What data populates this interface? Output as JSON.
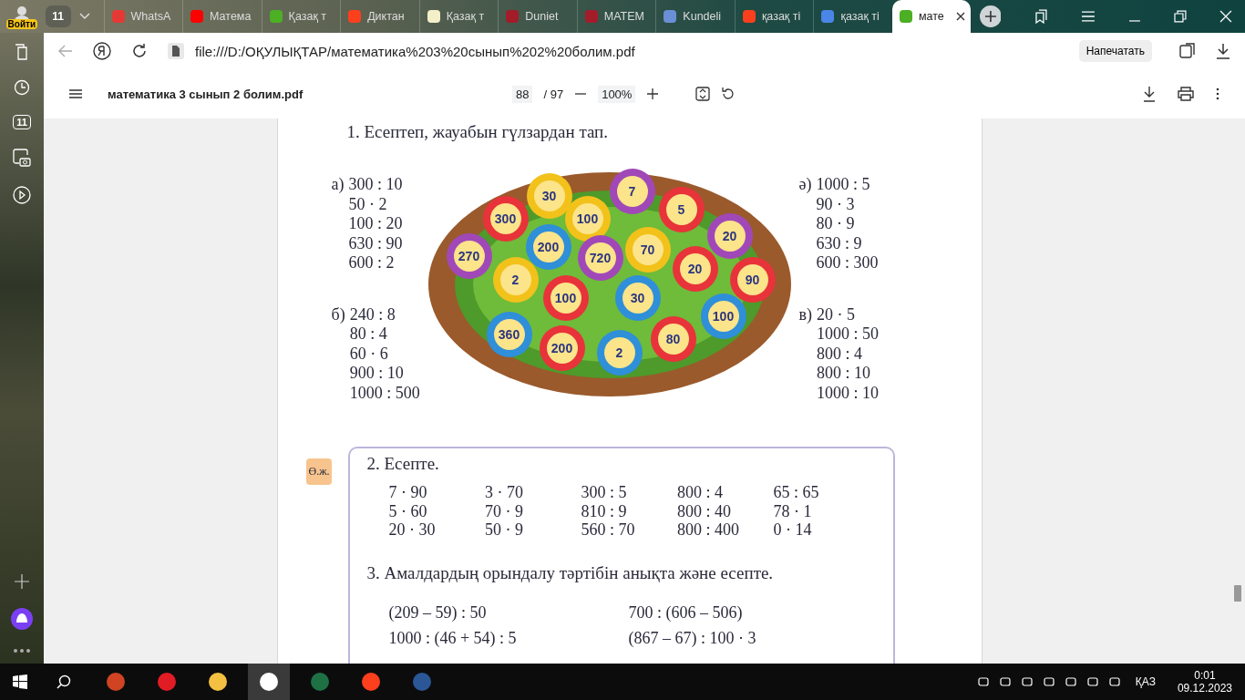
{
  "profile": {
    "label": "Войти"
  },
  "tab_group": {
    "count": "11"
  },
  "tabs": [
    {
      "title": "WhatsA",
      "selected": false,
      "color": "#e53935"
    },
    {
      "title": "Матема",
      "selected": false,
      "color": "#ff0000"
    },
    {
      "title": "Қазақ т",
      "selected": false,
      "color": "#4caf24"
    },
    {
      "title": "Диктан",
      "selected": false,
      "color": "#fc3f1d"
    },
    {
      "title": "Қазақ т",
      "selected": false,
      "color": "#f3efc8"
    },
    {
      "title": "Duniet",
      "selected": false,
      "color": "#a31c2a"
    },
    {
      "title": "MATEM",
      "selected": false,
      "color": "#a31c2a"
    },
    {
      "title": "Kundeli",
      "selected": false,
      "color": "#6b8fd6"
    },
    {
      "title": "қазақ ті",
      "selected": false,
      "color": "#fc3f1d"
    },
    {
      "title": "қазақ ті",
      "selected": false,
      "color": "#4a86e8"
    },
    {
      "title": "мате",
      "selected": true,
      "color": "#4caf24"
    }
  ],
  "address_bar": {
    "url": "file:///D:/ОҚУЛЫҚТАР/математика%203%20сынып%202%20болим.pdf",
    "print_button": "Напечатать"
  },
  "sidebar": {
    "badge": "11"
  },
  "pdf_toolbar": {
    "filename": "математика 3 сынып 2 болим.pdf",
    "page": "88",
    "total": "/ 97",
    "zoom": "100%"
  },
  "document": {
    "exercise1": {
      "title": "1. Есептеп, жауабын гүлзардан тап.",
      "left_groups": [
        {
          "label": "а)",
          "items": [
            "300 : 10",
            "50 · 2",
            "100 : 20",
            "630 : 90",
            "600 : 2"
          ]
        },
        {
          "label": "б)",
          "items": [
            "240 : 8",
            "80 : 4",
            "60 · 6",
            "900 : 10",
            "1000 : 500"
          ]
        }
      ],
      "right_groups": [
        {
          "label": "ә)",
          "items": [
            "1000 : 5",
            "90 · 3",
            "80 · 9",
            "630 : 9",
            "600 : 300"
          ]
        },
        {
          "label": "в)",
          "items": [
            "20 · 5",
            "1000 : 50",
            "800 : 4",
            "800 : 10",
            "1000 : 10"
          ]
        }
      ],
      "flowers": [
        {
          "value": "30",
          "color": "#f2c21b"
        },
        {
          "value": "7",
          "color": "#a148b8"
        },
        {
          "value": "300",
          "color": "#e8333a"
        },
        {
          "value": "100",
          "color": "#f2c21b"
        },
        {
          "value": "5",
          "color": "#e8333a"
        },
        {
          "value": "20",
          "color": "#a148b8"
        },
        {
          "value": "200",
          "color": "#2f8fd8"
        },
        {
          "value": "720",
          "color": "#a148b8"
        },
        {
          "value": "70",
          "color": "#f2c21b"
        },
        {
          "value": "270",
          "color": "#a148b8"
        },
        {
          "value": "2",
          "color": "#f2c21b"
        },
        {
          "value": "20",
          "color": "#e8333a"
        },
        {
          "value": "90",
          "color": "#e8333a"
        },
        {
          "value": "100",
          "color": "#e8333a"
        },
        {
          "value": "30",
          "color": "#2f8fd8"
        },
        {
          "value": "100",
          "color": "#2f8fd8"
        },
        {
          "value": "360",
          "color": "#2f8fd8"
        },
        {
          "value": "80",
          "color": "#e8333a"
        },
        {
          "value": "200",
          "color": "#e8333a"
        },
        {
          "value": "2",
          "color": "#2f8fd8"
        }
      ]
    },
    "exercise2": {
      "badge": "Ө.ж.",
      "title": "2. Есепте.",
      "rows": [
        [
          "7 · 90",
          "3 · 70",
          "300 : 5",
          "800 : 4",
          "65 : 65"
        ],
        [
          "5 · 60",
          "70 · 9",
          "810 : 9",
          "800 : 40",
          "78 · 1"
        ],
        [
          "20 · 30",
          "50 · 9",
          "560 : 70",
          "800 : 400",
          "0 · 14"
        ]
      ]
    },
    "exercise3": {
      "title": "3. Амалдардың орындалу тәртібін анықта және есепте.",
      "rows": [
        [
          "(209 – 59) : 50",
          "700 : (606 – 506)"
        ],
        [
          "1000 : (46 + 54) : 5",
          "(867 – 67) : 100 · 3"
        ]
      ]
    }
  },
  "taskbar": {
    "language": "ҚАЗ",
    "time": "0:01",
    "date": "09.12.2023"
  }
}
